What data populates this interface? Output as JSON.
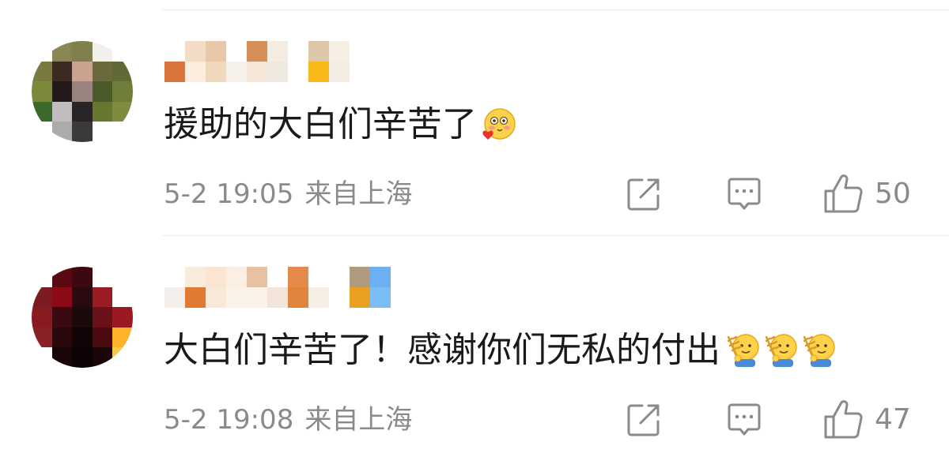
{
  "comments": [
    {
      "text": "援助的大白们辛苦了",
      "emojis": [
        "blush-heart-emoji"
      ],
      "date": "5-2 19:05",
      "location": "来自上海",
      "likes": "50"
    },
    {
      "text": "大白们辛苦了！感谢你们无私的付出",
      "emojis": [
        "wheat-hug-emoji",
        "wheat-hug-emoji",
        "wheat-hug-emoji"
      ],
      "date": "5-2 19:08",
      "location": "来自上海",
      "likes": "47"
    }
  ],
  "icons": {
    "share": "share-icon",
    "reply": "reply-icon",
    "like": "thumbs-up-icon"
  },
  "colors": {
    "text": "#1a1a1a",
    "meta": "#8a8a8a",
    "divider": "#ececec"
  }
}
